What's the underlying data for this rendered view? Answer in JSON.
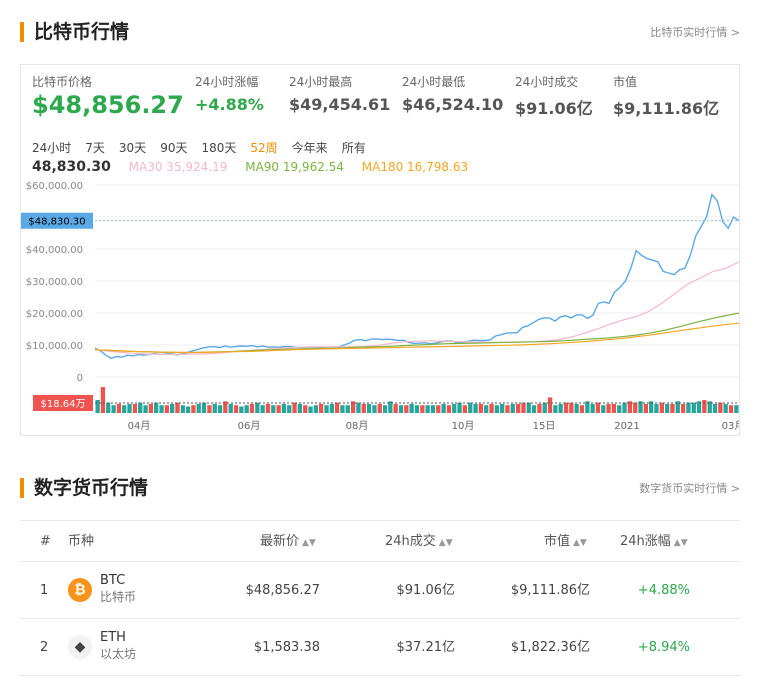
{
  "section1": {
    "title": "比特币行情",
    "link": "比特币实时行情 >"
  },
  "stats": [
    {
      "label": "比特币价格",
      "value": "$48,856.27"
    },
    {
      "label": "24小时涨幅",
      "value": "+4.88%"
    },
    {
      "label": "24小时最高",
      "value": "$49,454.61"
    },
    {
      "label": "24小时最低",
      "value": "$46,524.10"
    },
    {
      "label": "24小时成交",
      "value": "$91.06亿"
    },
    {
      "label": "市值",
      "value": "$9,111.86亿"
    }
  ],
  "periods": [
    "24小时",
    "7天",
    "30天",
    "90天",
    "180天",
    "52周",
    "今年来",
    "所有"
  ],
  "active_period": "52周",
  "ma": {
    "current": "48,830.30",
    "ma30": "MA30 35,924.19",
    "ma90": "MA90 19,962.54",
    "ma180": "MA180 16,798.63"
  },
  "colors": {
    "price": "#5aa9e6",
    "ma30": "#f5b8c8",
    "ma90": "#7cb342",
    "ma180": "#f5a623",
    "up": "#2ea84c",
    "bar_green": "#26a69a",
    "bar_red": "#ef5350",
    "accent": "#f08c00"
  },
  "chart_data": {
    "type": "line",
    "title": "",
    "y_ticks": [
      "$60,000.00",
      "$50,000.00",
      "$40,000.00",
      "$30,000.00",
      "$20,000.00",
      "$10,000.00",
      "0"
    ],
    "ylim": [
      0,
      60000
    ],
    "x_ticks": [
      "04月",
      "06月",
      "08月",
      "10月",
      "15日",
      "2021",
      "03月"
    ],
    "price_label": "$48,830.30",
    "volume_label": "$18.64万",
    "series": [
      {
        "key": "price",
        "values": [
          9000,
          8200,
          6800,
          5800,
          6400,
          6200,
          6800,
          6600,
          7000,
          6800,
          7100,
          7300,
          7000,
          7200,
          7400,
          6900,
          7200,
          7600,
          8200,
          8600,
          9100,
          9400,
          9500,
          9200,
          9700,
          9300,
          9500,
          9700,
          9600,
          9800,
          9400,
          9700,
          9300,
          9400,
          9300,
          9500,
          9500,
          9300,
          9200,
          9300,
          9400,
          9200,
          9300,
          9200,
          9400,
          9300,
          10000,
          10600,
          11500,
          11700,
          11300,
          11800,
          11900,
          11700,
          11800,
          11700,
          11400,
          11500,
          10800,
          10500,
          10600,
          10700,
          10400,
          10600,
          11000,
          11300,
          11200,
          10700,
          10800,
          11200,
          11500,
          11400,
          11400,
          11600,
          12800,
          13200,
          13700,
          13800,
          13800,
          15500,
          16000,
          17000,
          18000,
          18500,
          18400,
          17500,
          18800,
          19100,
          18500,
          19400,
          19400,
          18300,
          19300,
          23000,
          23500,
          23000,
          26500,
          28000,
          30000,
          34000,
          39500,
          38000,
          37000,
          36500,
          36000,
          33000,
          32500,
          32000,
          33500,
          34000,
          38000,
          44000,
          47000,
          50000,
          57000,
          55000,
          48500,
          46500,
          50000,
          48830
        ]
      },
      {
        "key": "ma30",
        "values": [
          8500,
          8100,
          7700,
          7400,
          7200,
          7100,
          7100,
          7100,
          7200,
          7300,
          7600,
          8000,
          8300,
          8600,
          8900,
          9100,
          9300,
          9400,
          9400,
          9400,
          9500,
          9600,
          9900,
          10500,
          11000,
          11200,
          11300,
          11200,
          11100,
          11000,
          10900,
          10800,
          10800,
          10900,
          11000,
          11300,
          11700,
          12500,
          13700,
          15000,
          16500,
          17800,
          18900,
          20500,
          23000,
          26000,
          29000,
          31000,
          33000,
          34000,
          35924
        ]
      },
      {
        "key": "ma90",
        "values": [
          8500,
          8300,
          8100,
          7900,
          7800,
          7700,
          7650,
          7700,
          7800,
          7900,
          8100,
          8300,
          8500,
          8700,
          8800,
          8900,
          9000,
          9100,
          9300,
          9400,
          9600,
          9800,
          10000,
          10200,
          10400,
          10500,
          10600,
          10700,
          10800,
          10900,
          11000,
          11100,
          11300,
          11600,
          11900,
          12200,
          12600,
          13100,
          13800,
          14700,
          15800,
          17000,
          18100,
          19100,
          19963
        ]
      },
      {
        "key": "ma180",
        "values": [
          8500,
          8300,
          8100,
          7900,
          7800,
          7700,
          7650,
          7700,
          7800,
          7900,
          8000,
          8200,
          8400,
          8600,
          8700,
          8800,
          8900,
          9000,
          9100,
          9200,
          9300,
          9400,
          9500,
          9600,
          9700,
          9800,
          9900,
          10000,
          10200,
          10400,
          10700,
          11000,
          11400,
          11800,
          12300,
          12900,
          13600,
          14300,
          15000,
          15700,
          16300,
          16799
        ]
      }
    ],
    "volume": [
      0.5,
      1.0,
      0.4,
      0.3,
      0.35,
      0.3,
      0.35,
      0.35,
      0.4,
      0.3,
      0.35,
      0.4,
      0.3,
      0.3,
      0.35,
      0.4,
      0.3,
      0.25,
      0.3,
      0.35,
      0.4,
      0.3,
      0.35,
      0.3,
      0.45,
      0.35,
      0.3,
      0.25,
      0.3,
      0.35,
      0.4,
      0.3,
      0.35,
      0.3,
      0.3,
      0.35,
      0.3,
      0.4,
      0.35,
      0.3,
      0.25,
      0.3,
      0.35,
      0.3,
      0.35,
      0.4,
      0.3,
      0.3,
      0.45,
      0.4,
      0.35,
      0.35,
      0.3,
      0.35,
      0.3,
      0.45,
      0.35,
      0.3,
      0.3,
      0.35,
      0.3,
      0.3,
      0.3,
      0.3,
      0.3,
      0.35,
      0.3,
      0.35,
      0.4,
      0.3,
      0.4,
      0.35,
      0.35,
      0.3,
      0.35,
      0.3,
      0.35,
      0.3,
      0.35,
      0.35,
      0.4,
      0.4,
      0.3,
      0.35,
      0.4,
      0.6,
      0.3,
      0.35,
      0.4,
      0.4,
      0.35,
      0.3,
      0.45,
      0.35,
      0.4,
      0.3,
      0.35,
      0.35,
      0.3,
      0.4,
      0.45,
      0.4,
      0.45,
      0.35,
      0.45,
      0.35,
      0.4,
      0.35,
      0.35,
      0.45,
      0.35,
      0.4,
      0.4,
      0.45,
      0.5,
      0.45,
      0.35,
      0.4,
      0.35,
      0.3,
      0.3
    ],
    "volume_up": [
      1,
      0,
      1,
      1,
      0,
      1,
      1,
      0,
      1,
      1,
      0,
      1,
      1,
      0,
      1,
      0,
      1,
      1,
      0,
      1,
      1,
      0,
      1,
      1,
      0,
      1,
      0,
      1,
      1,
      0,
      1,
      1,
      0,
      1,
      0,
      1,
      1,
      0,
      1,
      0,
      1,
      1,
      0,
      1,
      1,
      0,
      1,
      1,
      0,
      1,
      0,
      1,
      1,
      0,
      1,
      1,
      0,
      1,
      0,
      1,
      1,
      0,
      1,
      1,
      0,
      1,
      0,
      1,
      1,
      0,
      1,
      1,
      0,
      1,
      0,
      1,
      1,
      0,
      1,
      0,
      0,
      1,
      1,
      0,
      1,
      0,
      1,
      1,
      0,
      0,
      1,
      0,
      1,
      1,
      0,
      1,
      0,
      0,
      1,
      1,
      0,
      0,
      1,
      0,
      1,
      1,
      0,
      1,
      0,
      1,
      0,
      1,
      1,
      1,
      0,
      1,
      1,
      0,
      1,
      0,
      1
    ]
  },
  "section2": {
    "title": "数字货币行情",
    "link": "数字货币实时行情 >"
  },
  "table": {
    "headers": [
      "#",
      "币种",
      "最新价",
      "24h成交",
      "市值",
      "24h涨幅"
    ],
    "rows": [
      {
        "rank": "1",
        "symbol": "BTC",
        "name": "比特币",
        "price": "$48,856.27",
        "volume": "$91.06亿",
        "cap": "$9,111.86亿",
        "change": "+4.88%",
        "icon": "bitcoin-icon",
        "icon_glyph": "₿"
      },
      {
        "rank": "2",
        "symbol": "ETH",
        "name": "以太坊",
        "price": "$1,583.38",
        "volume": "$37.21亿",
        "cap": "$1,822.36亿",
        "change": "+8.94%",
        "icon": "ethereum-icon",
        "icon_glyph": "◆"
      }
    ]
  }
}
